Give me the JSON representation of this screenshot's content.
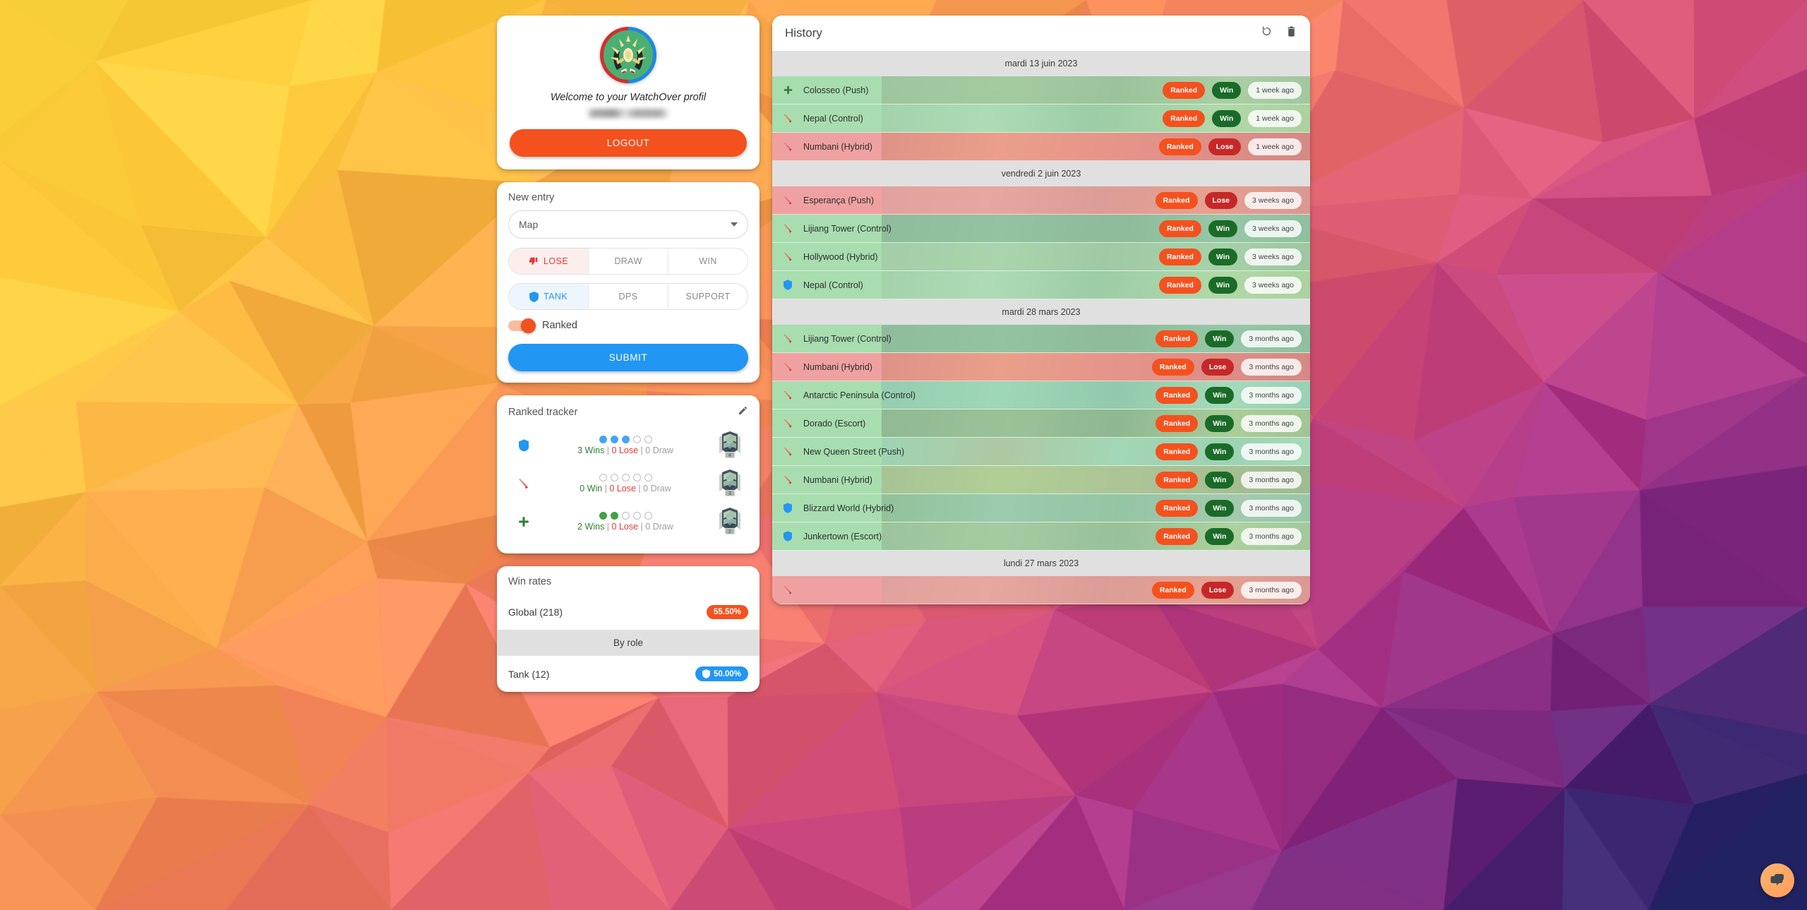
{
  "profile": {
    "welcome": "Welcome to your WatchOver profil",
    "logout_label": "LOGOUT",
    "avatar_icon": "overwatch-avatar"
  },
  "new_entry": {
    "title": "New entry",
    "map_select": {
      "value": "Map",
      "caret_icon": "chevron-down-icon"
    },
    "result_options": [
      "LOSE",
      "DRAW",
      "WIN"
    ],
    "result_selected": "LOSE",
    "role_options": [
      "TANK",
      "DPS",
      "SUPPORT"
    ],
    "role_selected": "TANK",
    "ranked_label": "Ranked",
    "ranked_on": true,
    "submit_label": "SUBMIT"
  },
  "ranked_tracker": {
    "title": "Ranked tracker",
    "edit_icon": "pencil-icon",
    "rows": [
      {
        "role": "tank",
        "role_icon": "shield-icon",
        "dots": [
          "blue",
          "blue",
          "blue",
          "empty",
          "empty"
        ],
        "wins": "3 Wins",
        "lose": "0 Lose",
        "draw": "0 Draw",
        "tier": "4"
      },
      {
        "role": "dps",
        "role_icon": "sword-icon",
        "dots": [
          "empty",
          "empty",
          "empty",
          "empty",
          "empty"
        ],
        "wins": "0 Win",
        "lose": "0 Lose",
        "draw": "0 Draw",
        "tier": "3"
      },
      {
        "role": "support",
        "role_icon": "cross-icon",
        "dots": [
          "green",
          "green",
          "empty",
          "empty",
          "empty"
        ],
        "wins": "2 Wins",
        "lose": "0 Lose",
        "draw": "0 Draw",
        "tier": "2"
      }
    ]
  },
  "win_rates": {
    "title": "Win rates",
    "global_label": "Global (218)",
    "global_value": "55.50%",
    "by_role_label": "By role",
    "roles": [
      {
        "label": "Tank (12)",
        "value": "50.00%",
        "icon": "shield-icon"
      }
    ]
  },
  "history": {
    "title": "History",
    "refresh_icon": "restore-icon",
    "delete_icon": "trash-icon",
    "groups": [
      {
        "date": "mardi 13 juin 2023",
        "entries": [
          {
            "role": "support",
            "map": "Colosseo (Push)",
            "mode": "Ranked",
            "result": "Win",
            "time": "1 week ago",
            "thumb": "colosseo"
          },
          {
            "role": "dps",
            "map": "Nepal (Control)",
            "mode": "Ranked",
            "result": "Win",
            "time": "1 week ago",
            "thumb": "nepal"
          },
          {
            "role": "dps",
            "map": "Numbani (Hybrid)",
            "mode": "Ranked",
            "result": "Lose",
            "time": "1 week ago",
            "thumb": "numbani"
          }
        ]
      },
      {
        "date": "vendredi 2 juin 2023",
        "entries": [
          {
            "role": "dps",
            "map": "Esperança (Push)",
            "mode": "Ranked",
            "result": "Lose",
            "time": "3 weeks ago",
            "thumb": "esperanca"
          },
          {
            "role": "dps",
            "map": "Lijiang Tower (Control)",
            "mode": "Ranked",
            "result": "Win",
            "time": "3 weeks ago",
            "thumb": "lijiang"
          },
          {
            "role": "dps",
            "map": "Hollywood (Hybrid)",
            "mode": "Ranked",
            "result": "Win",
            "time": "3 weeks ago",
            "thumb": "hollywood"
          },
          {
            "role": "tank",
            "map": "Nepal (Control)",
            "mode": "Ranked",
            "result": "Win",
            "time": "3 weeks ago",
            "thumb": "nepal"
          }
        ]
      },
      {
        "date": "mardi 28 mars 2023",
        "entries": [
          {
            "role": "dps",
            "map": "Lijiang Tower (Control)",
            "mode": "Ranked",
            "result": "Win",
            "time": "3 months ago",
            "thumb": "lijiang"
          },
          {
            "role": "dps",
            "map": "Numbani (Hybrid)",
            "mode": "Ranked",
            "result": "Lose",
            "time": "3 months ago",
            "thumb": "numbani"
          },
          {
            "role": "dps",
            "map": "Antarctic Peninsula (Control)",
            "mode": "Ranked",
            "result": "Win",
            "time": "3 months ago",
            "thumb": "antarctic"
          },
          {
            "role": "dps",
            "map": "Dorado (Escort)",
            "mode": "Ranked",
            "result": "Win",
            "time": "3 months ago",
            "thumb": "dorado"
          },
          {
            "role": "dps",
            "map": "New Queen Street (Push)",
            "mode": "Ranked",
            "result": "Win",
            "time": "3 months ago",
            "thumb": "newqueen"
          },
          {
            "role": "dps",
            "map": "Numbani (Hybrid)",
            "mode": "Ranked",
            "result": "Win",
            "time": "3 months ago",
            "thumb": "numbani"
          },
          {
            "role": "tank",
            "map": "Blizzard World (Hybrid)",
            "mode": "Ranked",
            "result": "Win",
            "time": "3 months ago",
            "thumb": "blizzard"
          },
          {
            "role": "tank",
            "map": "Junkertown (Escort)",
            "mode": "Ranked",
            "result": "Win",
            "time": "3 months ago",
            "thumb": "junkertown"
          }
        ]
      },
      {
        "date": "lundi 27 mars 2023",
        "entries": [
          {
            "role": "dps",
            "map": "",
            "mode": "Ranked",
            "result": "Lose",
            "time": "3 months ago",
            "thumb": "esperanca"
          }
        ]
      }
    ]
  },
  "chat_widget": {
    "icon": "chat-bubbles-icon"
  },
  "colors": {
    "accent_orange": "#f4511e",
    "accent_blue": "#2196f3",
    "win_green": "#1b6b28",
    "lose_red": "#c62828",
    "row_win_bg": "#a8ddaf",
    "row_lose_bg": "#efa1a1"
  }
}
